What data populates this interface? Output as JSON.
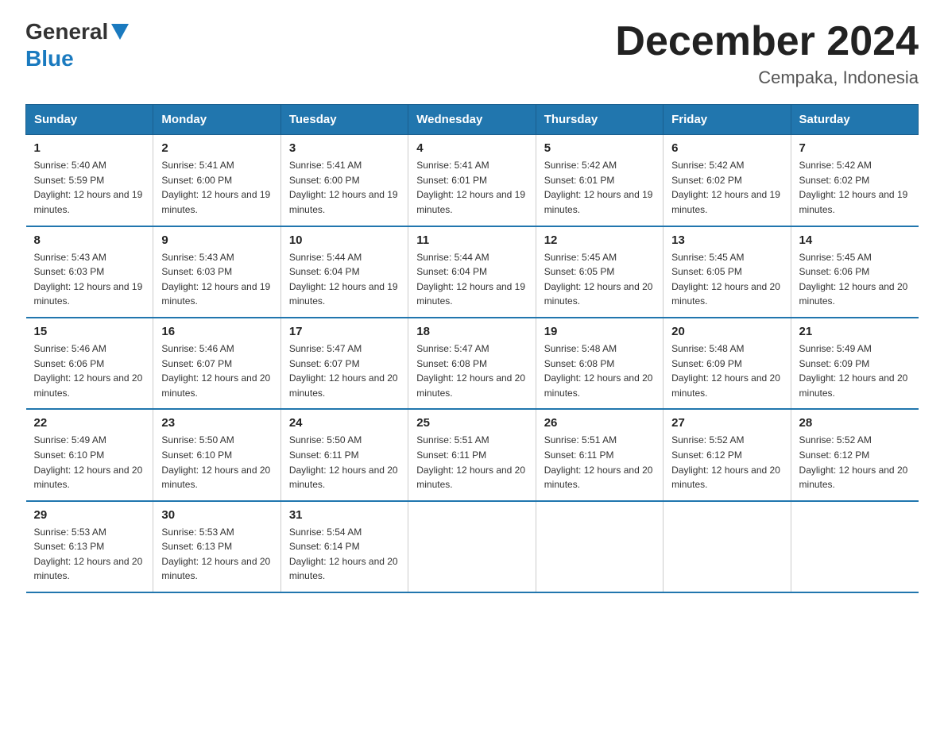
{
  "header": {
    "logo_general": "General",
    "logo_blue": "Blue",
    "month_title": "December 2024",
    "location": "Cempaka, Indonesia"
  },
  "days_of_week": [
    "Sunday",
    "Monday",
    "Tuesday",
    "Wednesday",
    "Thursday",
    "Friday",
    "Saturday"
  ],
  "weeks": [
    [
      {
        "day": "1",
        "sunrise": "5:40 AM",
        "sunset": "5:59 PM",
        "daylight": "12 hours and 19 minutes."
      },
      {
        "day": "2",
        "sunrise": "5:41 AM",
        "sunset": "6:00 PM",
        "daylight": "12 hours and 19 minutes."
      },
      {
        "day": "3",
        "sunrise": "5:41 AM",
        "sunset": "6:00 PM",
        "daylight": "12 hours and 19 minutes."
      },
      {
        "day": "4",
        "sunrise": "5:41 AM",
        "sunset": "6:01 PM",
        "daylight": "12 hours and 19 minutes."
      },
      {
        "day": "5",
        "sunrise": "5:42 AM",
        "sunset": "6:01 PM",
        "daylight": "12 hours and 19 minutes."
      },
      {
        "day": "6",
        "sunrise": "5:42 AM",
        "sunset": "6:02 PM",
        "daylight": "12 hours and 19 minutes."
      },
      {
        "day": "7",
        "sunrise": "5:42 AM",
        "sunset": "6:02 PM",
        "daylight": "12 hours and 19 minutes."
      }
    ],
    [
      {
        "day": "8",
        "sunrise": "5:43 AM",
        "sunset": "6:03 PM",
        "daylight": "12 hours and 19 minutes."
      },
      {
        "day": "9",
        "sunrise": "5:43 AM",
        "sunset": "6:03 PM",
        "daylight": "12 hours and 19 minutes."
      },
      {
        "day": "10",
        "sunrise": "5:44 AM",
        "sunset": "6:04 PM",
        "daylight": "12 hours and 19 minutes."
      },
      {
        "day": "11",
        "sunrise": "5:44 AM",
        "sunset": "6:04 PM",
        "daylight": "12 hours and 19 minutes."
      },
      {
        "day": "12",
        "sunrise": "5:45 AM",
        "sunset": "6:05 PM",
        "daylight": "12 hours and 20 minutes."
      },
      {
        "day": "13",
        "sunrise": "5:45 AM",
        "sunset": "6:05 PM",
        "daylight": "12 hours and 20 minutes."
      },
      {
        "day": "14",
        "sunrise": "5:45 AM",
        "sunset": "6:06 PM",
        "daylight": "12 hours and 20 minutes."
      }
    ],
    [
      {
        "day": "15",
        "sunrise": "5:46 AM",
        "sunset": "6:06 PM",
        "daylight": "12 hours and 20 minutes."
      },
      {
        "day": "16",
        "sunrise": "5:46 AM",
        "sunset": "6:07 PM",
        "daylight": "12 hours and 20 minutes."
      },
      {
        "day": "17",
        "sunrise": "5:47 AM",
        "sunset": "6:07 PM",
        "daylight": "12 hours and 20 minutes."
      },
      {
        "day": "18",
        "sunrise": "5:47 AM",
        "sunset": "6:08 PM",
        "daylight": "12 hours and 20 minutes."
      },
      {
        "day": "19",
        "sunrise": "5:48 AM",
        "sunset": "6:08 PM",
        "daylight": "12 hours and 20 minutes."
      },
      {
        "day": "20",
        "sunrise": "5:48 AM",
        "sunset": "6:09 PM",
        "daylight": "12 hours and 20 minutes."
      },
      {
        "day": "21",
        "sunrise": "5:49 AM",
        "sunset": "6:09 PM",
        "daylight": "12 hours and 20 minutes."
      }
    ],
    [
      {
        "day": "22",
        "sunrise": "5:49 AM",
        "sunset": "6:10 PM",
        "daylight": "12 hours and 20 minutes."
      },
      {
        "day": "23",
        "sunrise": "5:50 AM",
        "sunset": "6:10 PM",
        "daylight": "12 hours and 20 minutes."
      },
      {
        "day": "24",
        "sunrise": "5:50 AM",
        "sunset": "6:11 PM",
        "daylight": "12 hours and 20 minutes."
      },
      {
        "day": "25",
        "sunrise": "5:51 AM",
        "sunset": "6:11 PM",
        "daylight": "12 hours and 20 minutes."
      },
      {
        "day": "26",
        "sunrise": "5:51 AM",
        "sunset": "6:11 PM",
        "daylight": "12 hours and 20 minutes."
      },
      {
        "day": "27",
        "sunrise": "5:52 AM",
        "sunset": "6:12 PM",
        "daylight": "12 hours and 20 minutes."
      },
      {
        "day": "28",
        "sunrise": "5:52 AM",
        "sunset": "6:12 PM",
        "daylight": "12 hours and 20 minutes."
      }
    ],
    [
      {
        "day": "29",
        "sunrise": "5:53 AM",
        "sunset": "6:13 PM",
        "daylight": "12 hours and 20 minutes."
      },
      {
        "day": "30",
        "sunrise": "5:53 AM",
        "sunset": "6:13 PM",
        "daylight": "12 hours and 20 minutes."
      },
      {
        "day": "31",
        "sunrise": "5:54 AM",
        "sunset": "6:14 PM",
        "daylight": "12 hours and 20 minutes."
      },
      null,
      null,
      null,
      null
    ]
  ]
}
